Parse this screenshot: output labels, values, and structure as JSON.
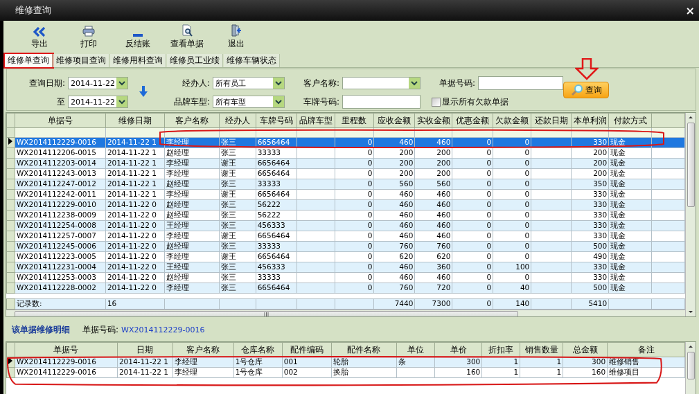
{
  "window": {
    "title": "维修查询",
    "close": "×"
  },
  "toolbar": [
    {
      "label": "导出"
    },
    {
      "label": "打印"
    },
    {
      "label": "反结账"
    },
    {
      "label": "查看单据"
    },
    {
      "label": "退出"
    }
  ],
  "tabs": [
    {
      "label": "维修单查询",
      "selected": true
    },
    {
      "label": "维修项目查询",
      "selected": false
    },
    {
      "label": "维修用料查询",
      "selected": false
    },
    {
      "label": "维修员工业绩",
      "selected": false
    },
    {
      "label": "维修车辆状态",
      "selected": false
    }
  ],
  "filters": {
    "date_label": "查询日期:",
    "date_from": "2014-11-22",
    "to_label": "至",
    "date_to": "2014-11-22",
    "handler_label": "经办人:",
    "handler_value": "所有员工",
    "brand_label": "品牌车型:",
    "brand_value": "所有车型",
    "customer_label": "客户名称:",
    "plate_label": "车牌号码:",
    "bill_no_label": "单据号码:",
    "arrears": {
      "label": "显示所有欠款单据",
      "checked": false
    },
    "query_button": "查询"
  },
  "grid": {
    "columns": [
      "单据号",
      "维修日期",
      "客户名称",
      "经办人",
      "车牌号码",
      "品牌车型",
      "里程数",
      "应收金额",
      "实收金额",
      "优惠金额",
      "欠款金额",
      "还款日期",
      "本单利润",
      "付款方式"
    ],
    "rows": [
      {
        "selected": true,
        "cells": [
          "WX2014112229-0016",
          "2014-11-22 1",
          "李经理",
          "张三",
          "6656464",
          null,
          "0",
          "460",
          "460",
          "0",
          "0",
          null,
          "330",
          "现金"
        ]
      },
      {
        "selected": false,
        "cells": [
          "WX2014112206-0015",
          "2014-11-22 1",
          "赵经理",
          "张三",
          "33333",
          null,
          "0",
          "200",
          "200",
          "0",
          "0",
          null,
          "200",
          "现金"
        ]
      },
      {
        "selected": false,
        "cells": [
          "WX2014112203-0014",
          "2014-11-22 1",
          "李经理",
          "谢王",
          "6656464",
          null,
          "0",
          "200",
          "200",
          "0",
          "0",
          null,
          "200",
          "现金"
        ]
      },
      {
        "selected": false,
        "cells": [
          "WX2014112243-0013",
          "2014-11-22 1",
          "李经理",
          "谢王",
          "6656464",
          null,
          "0",
          "200",
          "200",
          "0",
          "0",
          null,
          "200",
          "现金"
        ]
      },
      {
        "selected": false,
        "cells": [
          "WX2014112247-0012",
          "2014-11-22 1",
          "赵经理",
          "张三",
          "33333",
          null,
          "0",
          "560",
          "560",
          "0",
          "0",
          null,
          "350",
          "现金"
        ]
      },
      {
        "selected": false,
        "cells": [
          "WX2014112242-0011",
          "2014-11-22 1",
          "李经理",
          "谢王",
          "6656464",
          null,
          "0",
          "460",
          "460",
          "0",
          "0",
          null,
          "330",
          "现金"
        ]
      },
      {
        "selected": false,
        "cells": [
          "WX2014112229-0010",
          "2014-11-22 0",
          "赵经理",
          "张三",
          "56222",
          null,
          "0",
          "460",
          "460",
          "0",
          "0",
          null,
          "330",
          "现金"
        ]
      },
      {
        "selected": false,
        "cells": [
          "WX2014112238-0009",
          "2014-11-22 0",
          "赵经理",
          "张三",
          "56222",
          null,
          "0",
          "460",
          "460",
          "0",
          "0",
          null,
          "330",
          "现金"
        ]
      },
      {
        "selected": false,
        "cells": [
          "WX2014112254-0008",
          "2014-11-22 0",
          "王经理",
          "张三",
          "456333",
          null,
          "0",
          "460",
          "460",
          "0",
          "0",
          null,
          "330",
          "现金"
        ]
      },
      {
        "selected": false,
        "cells": [
          "WX2014112257-0007",
          "2014-11-22 0",
          "李经理",
          "谢王",
          "6656464",
          null,
          "0",
          "460",
          "460",
          "0",
          "0",
          null,
          "330",
          "现金"
        ]
      },
      {
        "selected": false,
        "cells": [
          "WX2014112245-0006",
          "2014-11-22 0",
          "赵经理",
          "张三",
          "33333",
          null,
          "0",
          "760",
          "760",
          "0",
          "0",
          null,
          "500",
          "现金"
        ]
      },
      {
        "selected": false,
        "cells": [
          "WX2014112223-0005",
          "2014-11-22 0",
          "李经理",
          "谢王",
          "6656464",
          null,
          "0",
          "620",
          "620",
          "0",
          "0",
          null,
          "490",
          "现金"
        ]
      },
      {
        "selected": false,
        "cells": [
          "WX2014112231-0004",
          "2014-11-22 0",
          "王经理",
          "张三",
          "456333",
          null,
          "0",
          "460",
          "360",
          "0",
          "100",
          null,
          "330",
          "现金"
        ]
      },
      {
        "selected": false,
        "cells": [
          "WX2014112253-0003",
          "2014-11-22 0",
          "赵经理",
          "张三",
          "33333",
          null,
          "0",
          "460",
          "460",
          "0",
          "0",
          null,
          "330",
          "现金"
        ]
      },
      {
        "selected": false,
        "cells": [
          "WX2014112228-0002",
          "2014-11-22 0",
          "李经理",
          "张三",
          "6656464",
          null,
          "0",
          "760",
          "720",
          "0",
          "40",
          null,
          "500",
          "现金"
        ]
      }
    ],
    "summary": {
      "label": "记录数:",
      "count": "16",
      "receivable": "7440",
      "received": "7300",
      "discount": "0",
      "arrears": "140",
      "profit": "5410"
    }
  },
  "detail": {
    "title": "该单据维修明细",
    "bill_no_label": "单据号码:",
    "bill_no": "WX2014112229-0016",
    "columns": [
      "单据号",
      "日期",
      "客户名称",
      "仓库名称",
      "配件编码",
      "配件名称",
      "单位",
      "单价",
      "折扣率",
      "销售数量",
      "总金额",
      "备注"
    ],
    "rows": [
      {
        "selected": true,
        "cells": [
          "WX2014112229-0016",
          "2014-11-22 1",
          "李经理",
          "1号仓库",
          "001",
          "轮胎",
          "条",
          "300",
          "1",
          "1",
          "300",
          "维修销售"
        ]
      },
      {
        "selected": false,
        "cells": [
          "WX2014112229-0016",
          "2014-11-22 1",
          "李经理",
          "1号仓库",
          "002",
          "换胎",
          null,
          "160",
          "1",
          "1",
          "160",
          "维修项目"
        ]
      }
    ]
  }
}
